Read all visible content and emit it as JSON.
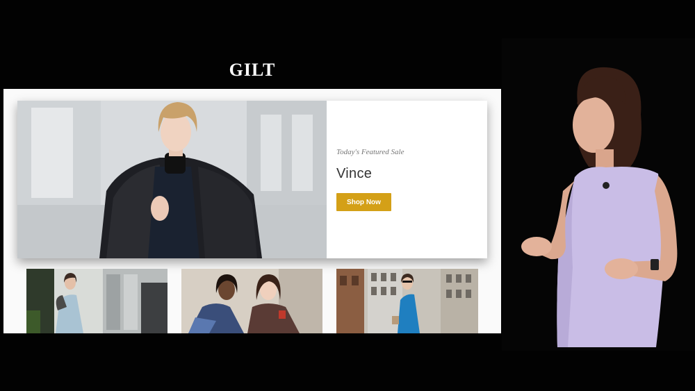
{
  "app": {
    "logo_text": "GILT"
  },
  "featured_sale": {
    "label": "Today's Featured Sale",
    "brand": "Vince",
    "cta_label": "Shop Now"
  },
  "colors": {
    "accent": "#d4a017",
    "background": "#000000",
    "screen": "#fafafa"
  },
  "tiles": [
    {
      "name": "sale-tile-1"
    },
    {
      "name": "sale-tile-2"
    },
    {
      "name": "sale-tile-3"
    }
  ]
}
